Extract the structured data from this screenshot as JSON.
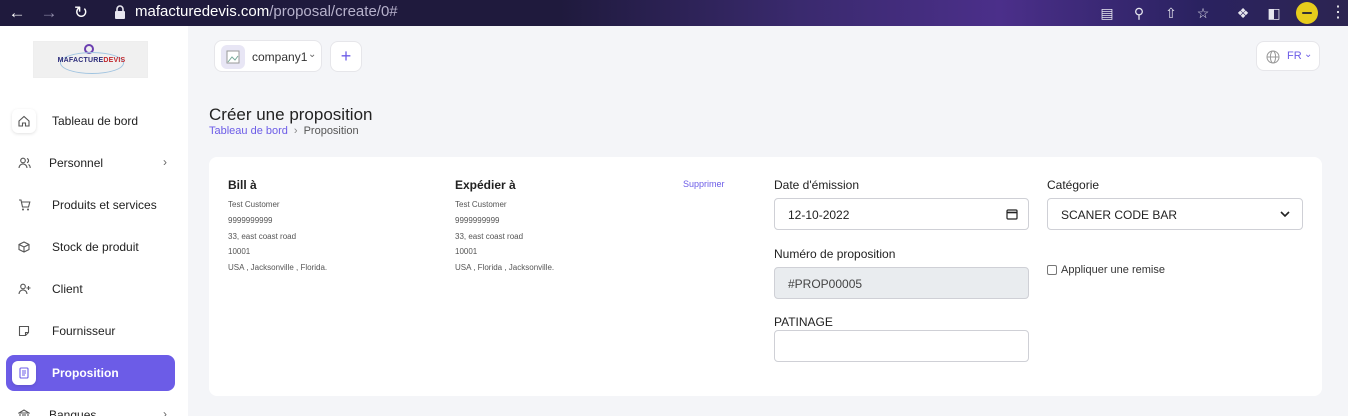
{
  "browser": {
    "url_host": "mafacturedevis.com",
    "url_path": "/proposal/create/0#"
  },
  "logo": {
    "text_main": "MAFACTURE",
    "text_accent": "DEVIS"
  },
  "sidebar": {
    "items": [
      {
        "label": "Tableau de bord",
        "icon": "home-icon",
        "has_chevron": false,
        "active": false
      },
      {
        "label": "Personnel",
        "icon": "users-icon",
        "has_chevron": true,
        "active": false
      },
      {
        "label": "Produits et services",
        "icon": "cart-icon",
        "has_chevron": false,
        "active": false
      },
      {
        "label": "Stock de produit",
        "icon": "box-icon",
        "has_chevron": false,
        "active": false
      },
      {
        "label": "Client",
        "icon": "user-plus-icon",
        "has_chevron": false,
        "active": false
      },
      {
        "label": "Fournisseur",
        "icon": "note-icon",
        "has_chevron": false,
        "active": false
      },
      {
        "label": "Proposition",
        "icon": "document-icon",
        "has_chevron": false,
        "active": true
      },
      {
        "label": "Banques",
        "icon": "bank-icon",
        "has_chevron": true,
        "active": false
      }
    ]
  },
  "header": {
    "company_name": "company1",
    "add_label": "+",
    "language": "FR"
  },
  "page": {
    "title": "Créer une proposition",
    "breadcrumb": {
      "link": "Tableau de bord",
      "separator": "›",
      "current": "Proposition"
    }
  },
  "bill_to": {
    "title": "Bill à",
    "lines": [
      "Test Customer",
      "9999999999",
      "33, east coast road",
      "10001",
      "USA , Jacksonville , Florida."
    ]
  },
  "ship_to": {
    "title": "Expédier à",
    "delete_label": "Supprimer",
    "lines": [
      "Test Customer",
      "9999999999",
      "33, east coast road",
      "10001",
      "USA , Florida , Jacksonville."
    ]
  },
  "form": {
    "issue_date_label": "Date d'émission",
    "issue_date_value": "12-10-2022",
    "proposal_number_label": "Numéro de proposition",
    "proposal_number_value": "#PROP00005",
    "patinage_label": "PATINAGE",
    "patinage_value": "",
    "category_label": "Catégorie",
    "category_value": "SCANER CODE BAR",
    "discount_label": "Appliquer une remise",
    "discount_checked": false
  },
  "colors": {
    "accent": "#6c5ce7",
    "browser_bg": "#1f1a3d"
  }
}
